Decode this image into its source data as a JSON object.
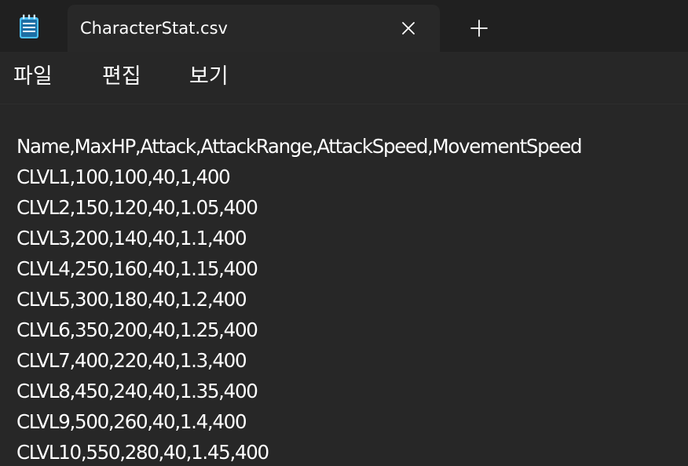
{
  "window": {
    "app_icon": "notepad-icon",
    "tab": {
      "title": "CharacterStat.csv",
      "close_icon": "close-icon"
    },
    "new_tab_icon": "plus-icon"
  },
  "menu": {
    "items": [
      {
        "label": "파일"
      },
      {
        "label": "편집"
      },
      {
        "label": "보기"
      }
    ]
  },
  "editor": {
    "lines": [
      "Name,MaxHP,Attack,AttackRange,AttackSpeed,MovementSpeed",
      "CLVL1,100,100,40,1,400",
      "CLVL2,150,120,40,1.05,400",
      "CLVL3,200,140,40,1.1,400",
      "CLVL4,250,160,40,1.15,400",
      "CLVL5,300,180,40,1.2,400",
      "CLVL6,350,200,40,1.25,400",
      "CLVL7,400,220,40,1.3,400",
      "CLVL8,450,240,40,1.35,400",
      "CLVL9,500,260,40,1.4,400",
      "CLVL10,550,280,40,1.45,400"
    ]
  },
  "colors": {
    "titlebar_bg": "#202020",
    "tab_bg": "#282828",
    "editor_bg": "#272727",
    "text": "#ffffff",
    "icon_accent": "#4cc2ff"
  }
}
